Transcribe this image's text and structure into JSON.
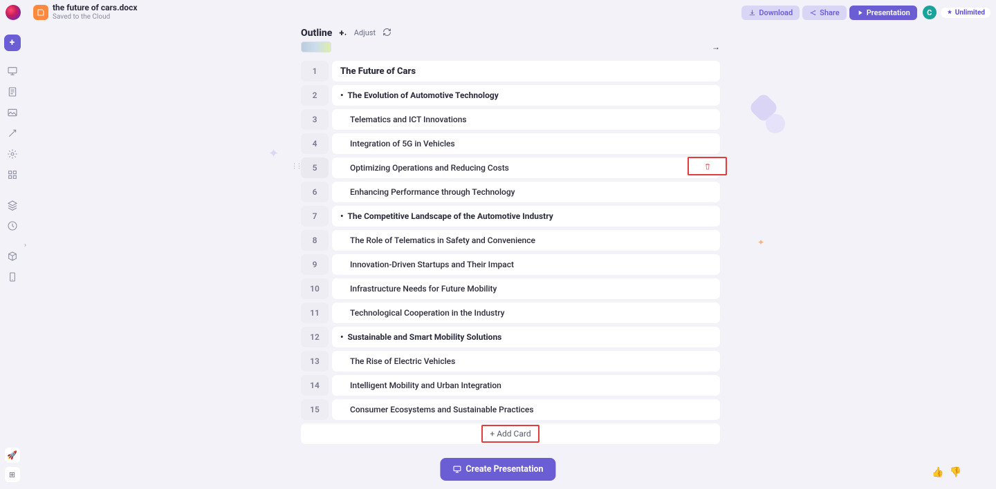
{
  "app": {
    "doc_title": "the future of cars.docx",
    "doc_subtitle": "Saved to the Cloud",
    "download_label": "Download",
    "share_label": "Share",
    "presentation_label": "Presentation",
    "avatar_initial": "C",
    "unlimited_label": "Unlimited"
  },
  "subhead": {
    "title": "Outline",
    "adjust": "Adjust"
  },
  "outline": {
    "items": [
      {
        "num": "1",
        "level": "h1",
        "text": "The Future of Cars"
      },
      {
        "num": "2",
        "level": "h2",
        "text": "The Evolution of Automotive Technology"
      },
      {
        "num": "3",
        "level": "h3",
        "text": "Telematics and ICT Innovations"
      },
      {
        "num": "4",
        "level": "h3",
        "text": "Integration of 5G in Vehicles"
      },
      {
        "num": "5",
        "level": "h3",
        "text": "Optimizing Operations and Reducing Costs",
        "hovered": true,
        "show_delete": true
      },
      {
        "num": "6",
        "level": "h3",
        "text": "Enhancing Performance through Technology"
      },
      {
        "num": "7",
        "level": "h2",
        "text": "The Competitive Landscape of the Automotive Industry"
      },
      {
        "num": "8",
        "level": "h3",
        "text": "The Role of Telematics in Safety and Convenience"
      },
      {
        "num": "9",
        "level": "h3",
        "text": "Innovation-Driven Startups and Their Impact"
      },
      {
        "num": "10",
        "level": "h3",
        "text": "Infrastructure Needs for Future Mobility"
      },
      {
        "num": "11",
        "level": "h3",
        "text": "Technological Cooperation in the Industry"
      },
      {
        "num": "12",
        "level": "h2",
        "text": "Sustainable and Smart Mobility Solutions"
      },
      {
        "num": "13",
        "level": "h3",
        "text": "The Rise of Electric Vehicles"
      },
      {
        "num": "14",
        "level": "h3",
        "text": "Intelligent Mobility and Urban Integration"
      },
      {
        "num": "15",
        "level": "h3",
        "text": "Consumer Ecosystems and Sustainable Practices"
      }
    ],
    "add_card_label": "+ Add Card"
  },
  "footer": {
    "create_label": "Create Presentation"
  }
}
